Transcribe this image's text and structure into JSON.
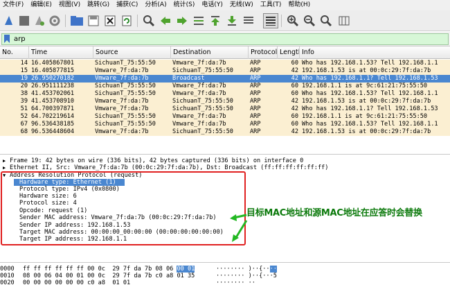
{
  "menu": [
    "文件(F)",
    "编辑(E)",
    "视图(V)",
    "跳转(G)",
    "捕获(C)",
    "分析(A)",
    "统计(S)",
    "电话(Y)",
    "无线(W)",
    "工具(T)",
    "帮助(H)"
  ],
  "filter": {
    "value": "arp",
    "icon": "bookmark-icon"
  },
  "packet_list": {
    "headers": [
      "No.",
      "Time",
      "Source",
      "Destination",
      "Protocol",
      "Length",
      "Info"
    ],
    "rows": [
      {
        "no": "14",
        "time": "16.405867801",
        "src": "SichuanT_75:55:50",
        "dst": "Vmware_7f:da:7b",
        "proto": "ARP",
        "len": "60",
        "info": "Who has 192.168.1.53? Tell 192.168.1.1"
      },
      {
        "no": "15",
        "time": "16.405877815",
        "src": "Vmware_7f:da:7b",
        "dst": "SichuanT_75:55:50",
        "proto": "ARP",
        "len": "42",
        "info": "192.168.1.53 is at 00:0c:29:7f:da:7b"
      },
      {
        "no": "19",
        "time": "26.950270182",
        "src": "Vmware_7f:da:7b",
        "dst": "Broadcast",
        "proto": "ARP",
        "len": "42",
        "info": "Who has 192.168.1.1? Tell 192.168.1.53",
        "selected": true
      },
      {
        "no": "20",
        "time": "26.951111238",
        "src": "SichuanT_75:55:50",
        "dst": "Vmware_7f:da:7b",
        "proto": "ARP",
        "len": "60",
        "info": "192.168.1.1 is at 9c:61:21:75:55:50"
      },
      {
        "no": "38",
        "time": "41.453702061",
        "src": "SichuanT_75:55:50",
        "dst": "Vmware_7f:da:7b",
        "proto": "ARP",
        "len": "60",
        "info": "Who has 192.168.1.53? Tell 192.168.1.1"
      },
      {
        "no": "39",
        "time": "41.453708910",
        "src": "Vmware_7f:da:7b",
        "dst": "SichuanT_75:55:50",
        "proto": "ARP",
        "len": "42",
        "info": "192.168.1.53 is at 00:0c:29:7f:da:7b"
      },
      {
        "no": "51",
        "time": "64.700397871",
        "src": "Vmware_7f:da:7b",
        "dst": "SichuanT_75:55:50",
        "proto": "ARP",
        "len": "42",
        "info": "Who has 192.168.1.1? Tell 192.168.1.53"
      },
      {
        "no": "52",
        "time": "64.702219614",
        "src": "SichuanT_75:55:50",
        "dst": "Vmware_7f:da:7b",
        "proto": "ARP",
        "len": "60",
        "info": "192.168.1.1 is at 9c:61:21:75:55:50"
      },
      {
        "no": "67",
        "time": "96.536438185",
        "src": "SichuanT_75:55:50",
        "dst": "Vmware_7f:da:7b",
        "proto": "ARP",
        "len": "60",
        "info": "Who has 192.168.1.53? Tell 192.168.1.1"
      },
      {
        "no": "68",
        "time": "96.536448604",
        "src": "Vmware_7f:da:7b",
        "dst": "SichuanT_75:55:50",
        "proto": "ARP",
        "len": "42",
        "info": "192.168.1.53 is at 00:0c:29:7f:da:7b"
      }
    ]
  },
  "details": {
    "frame": "Frame 19: 42 bytes on wire (336 bits), 42 bytes captured (336 bits) on interface 0",
    "ethernet": "Ethernet II, Src: Vmware_7f:da:7b (00:0c:29:7f:da:7b), Dst: Broadcast (ff:ff:ff:ff:ff:ff)",
    "arp_header": "Address Resolution Protocol (request)",
    "arp_fields": [
      "Hardware type: Ethernet (1)",
      "Protocol type: IPv4 (0x0800)",
      "Hardware size: 6",
      "Protocol size: 4",
      "Opcode: request (1)",
      "Sender MAC address: Vmware_7f:da:7b (00:0c:29:7f:da:7b)",
      "Sender IP address: 192.168.1.53",
      "Target MAC address: 00:00:00_00:00:00 (00:00:00:00:00:00)",
      "Target IP address: 192.168.1.1"
    ]
  },
  "annotation": "目标MAC地址和源MAC地址在应答时会替换",
  "bytes": [
    {
      "offset": "0000",
      "hex_pre": "ff ff ff ff ff ff 00 0c  29 7f da 7b 08 06 ",
      "hex_hl": "00 01",
      "ascii_pre": "········ )··{··",
      "ascii_hl": "··"
    },
    {
      "offset": "0010",
      "hex_pre": "08 00 06 04 00 01 00 0c  29 7f da 7b c0 a8 01 35",
      "hex_hl": "",
      "ascii_pre": "········ )··{···5",
      "ascii_hl": ""
    },
    {
      "offset": "0020",
      "hex_pre": "00 00 00 00 00 00 c0 a8  01 01",
      "hex_hl": "",
      "ascii_pre": "········ ··",
      "ascii_hl": ""
    }
  ],
  "colors": {
    "row_bg": "#fbefd2",
    "selected": "#4a87d0",
    "filter_bg": "#d7f7d7",
    "annotation": "#0c7a0c",
    "box": "#e02020"
  }
}
